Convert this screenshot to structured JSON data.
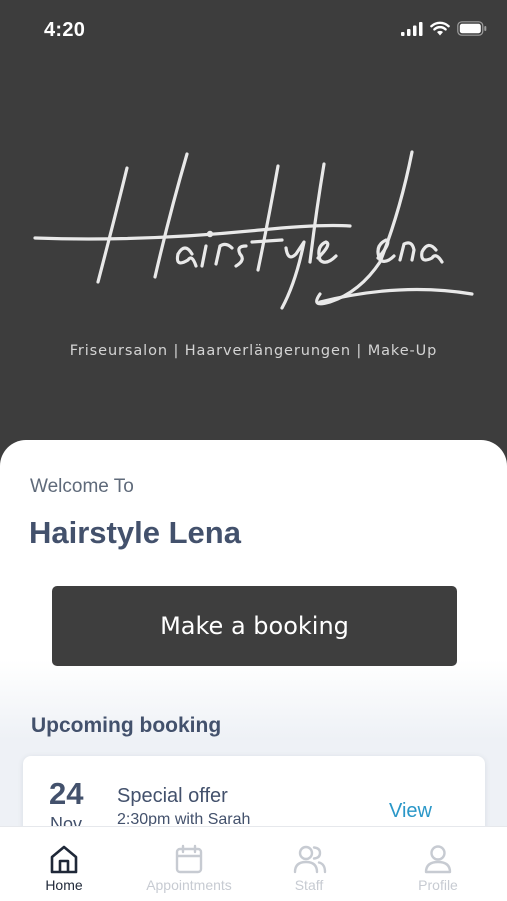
{
  "status_bar": {
    "time": "4:20",
    "icons": [
      "signal-icon",
      "wifi-icon",
      "battery-icon"
    ]
  },
  "hero": {
    "logo_text": "Hairstyle Lena",
    "tagline": "Friseursalon | Haarverlängerungen | Make-Up"
  },
  "main": {
    "welcome_label": "Welcome To",
    "salon_name": "Hairstyle Lena",
    "booking_button_label": "Make a booking",
    "upcoming_heading": "Upcoming booking",
    "upcoming": {
      "day": "24",
      "month": "Nov",
      "title": "Special offer",
      "subtitle": "2:30pm with Sarah",
      "action_label": "View"
    }
  },
  "tab_bar": {
    "tabs": [
      {
        "label": "Home",
        "icon": "home-icon",
        "active": true
      },
      {
        "label": "Appointments",
        "icon": "calendar-icon",
        "active": false
      },
      {
        "label": "Staff",
        "icon": "staff-icon",
        "active": false
      },
      {
        "label": "Profile",
        "icon": "profile-icon",
        "active": false
      }
    ]
  },
  "colors": {
    "hero_background": "#3d3d3d",
    "heading_text": "#43516c",
    "button_background": "#3e3e3e",
    "link": "#2a97c8",
    "tab_inactive": "#c7cbd2"
  }
}
